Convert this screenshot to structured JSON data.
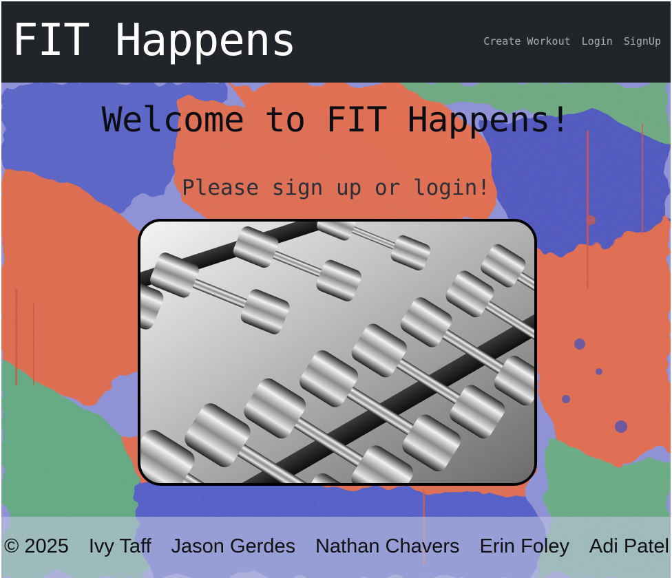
{
  "header": {
    "brand": "FIT Happens",
    "nav": [
      {
        "label": "Create Workout"
      },
      {
        "label": "Login"
      },
      {
        "label": "SignUp"
      }
    ]
  },
  "main": {
    "title": "Welcome to FIT Happens!",
    "subtitle": "Please sign up or login!",
    "hero_image": "dumbbell-rack-photo"
  },
  "footer": {
    "copyright": "© 2025",
    "authors": [
      "Ivy Taff",
      "Jason Gerdes",
      "Nathan Chavers",
      "Erin Foley",
      "Adi Patel"
    ]
  },
  "colors": {
    "header_bg": "#212529",
    "paint_orange": "#e06a4e",
    "paint_blue": "#4f5bc9",
    "paint_green": "#6aa97f",
    "paint_lavender": "#8c8fd8"
  }
}
